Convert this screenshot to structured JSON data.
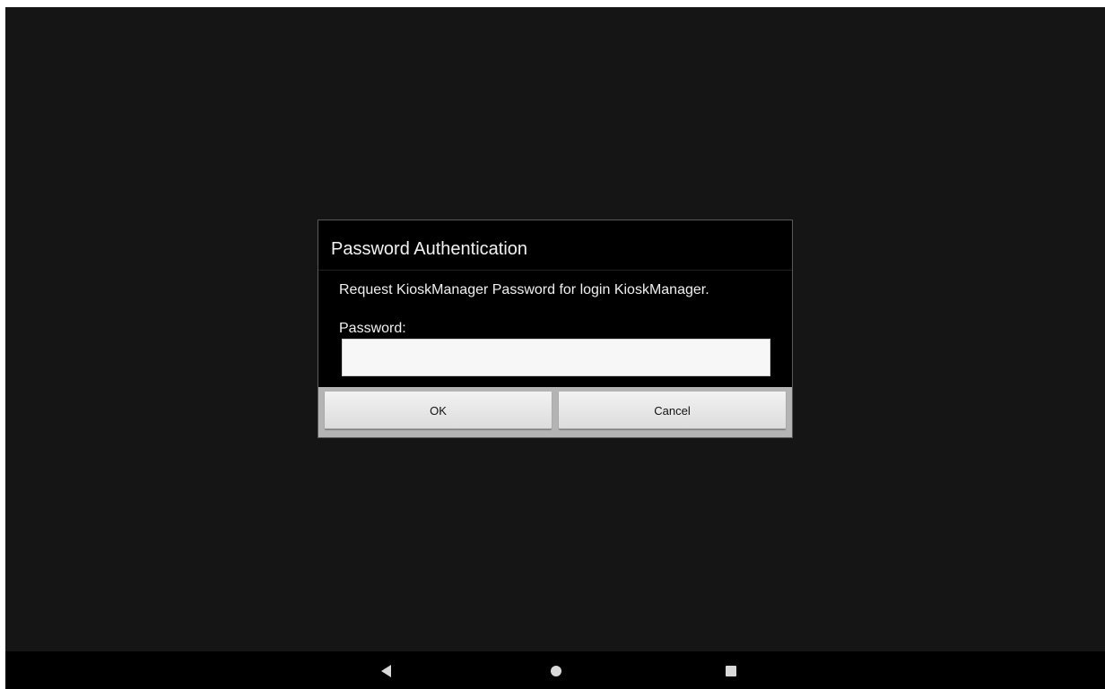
{
  "dialog": {
    "title": "Password Authentication",
    "message": "Request KioskManager Password for login KioskManager.",
    "password_label": "Password:",
    "password_value": "",
    "ok_label": "OK",
    "cancel_label": "Cancel"
  },
  "navbar": {
    "back_icon": "back-triangle-icon",
    "home_icon": "home-circle-icon",
    "recents_icon": "recents-square-icon"
  },
  "colors": {
    "background": "#151515",
    "dialog_background": "#000000",
    "button_bar": "#b4b4b4",
    "button_face": "#e8e8e8",
    "nav_icon": "#d9d9d9"
  }
}
